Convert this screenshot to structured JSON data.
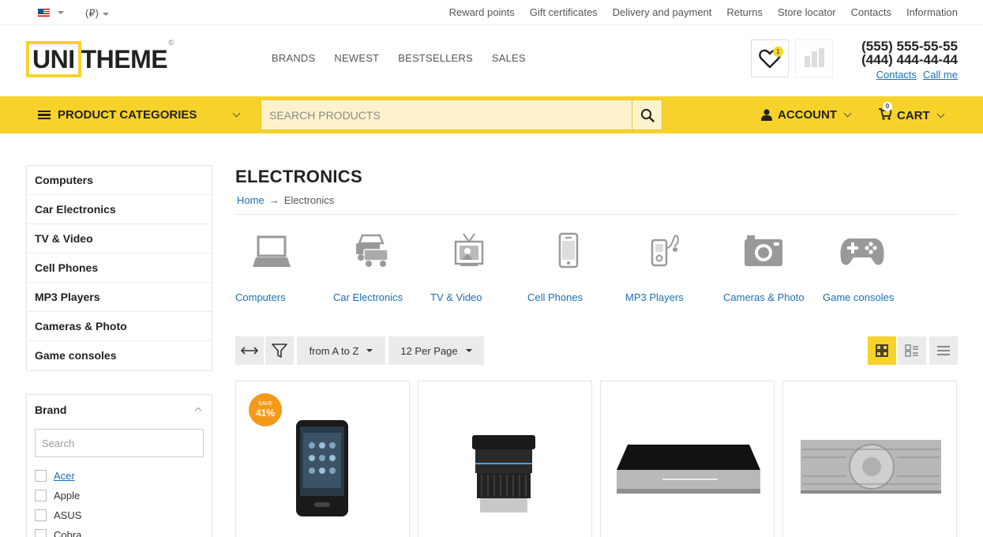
{
  "topbar": {
    "currency": "(₽)",
    "links": [
      "Reward points",
      "Gift certificates",
      "Delivery and payment",
      "Returns",
      "Store locator",
      "Contacts",
      "Information"
    ]
  },
  "header": {
    "logo_box": "UNI",
    "logo_rest": "THEME",
    "logo_mark": "©",
    "nav": [
      "BRANDS",
      "NEWEST",
      "BESTSELLERS",
      "SALES"
    ],
    "wishlist_count": "1",
    "phone1": "(555) 555-55-55",
    "phone2": "(444) 444-44-44",
    "contacts_link": "Contacts",
    "callme_link": "Call me"
  },
  "menubar": {
    "categories_label": "PRODUCT CATEGORIES",
    "search_placeholder": "SEARCH PRODUCTS",
    "account_label": "ACCOUNT",
    "cart_label": "CART",
    "cart_count": "0"
  },
  "sidebar": {
    "categories": [
      "Computers",
      "Car Electronics",
      "TV & Video",
      "Cell Phones",
      "MP3 Players",
      "Cameras & Photo",
      "Game consoles"
    ],
    "brand_title": "Brand",
    "brand_search_placeholder": "Search",
    "brands": [
      "Acer",
      "Apple",
      "ASUS",
      "Cobra"
    ]
  },
  "main": {
    "title": "ELECTRONICS",
    "breadcrumb": {
      "home": "Home",
      "separator": "→",
      "current": "Electronics"
    },
    "subcategories": [
      {
        "label": "Computers",
        "icon": "laptop-icon"
      },
      {
        "label": "Car Electronics",
        "icon": "cars-icon"
      },
      {
        "label": "TV & Video",
        "icon": "tv-icon"
      },
      {
        "label": "Cell Phones",
        "icon": "phone-icon"
      },
      {
        "label": "MP3 Players",
        "icon": "mp3-player-icon"
      },
      {
        "label": "Cameras & Photo",
        "icon": "camera-icon"
      },
      {
        "label": "Game consoles",
        "icon": "gamepad-icon"
      }
    ],
    "sort_label": "from A to Z",
    "perpage_label": "12 Per Page",
    "products": [
      {
        "save_label": "SAVE",
        "save_value": "41%"
      }
    ]
  },
  "colors": {
    "accent": "#f7d22a",
    "link": "#1a6fb5",
    "save_badge": "#f49a1a"
  }
}
